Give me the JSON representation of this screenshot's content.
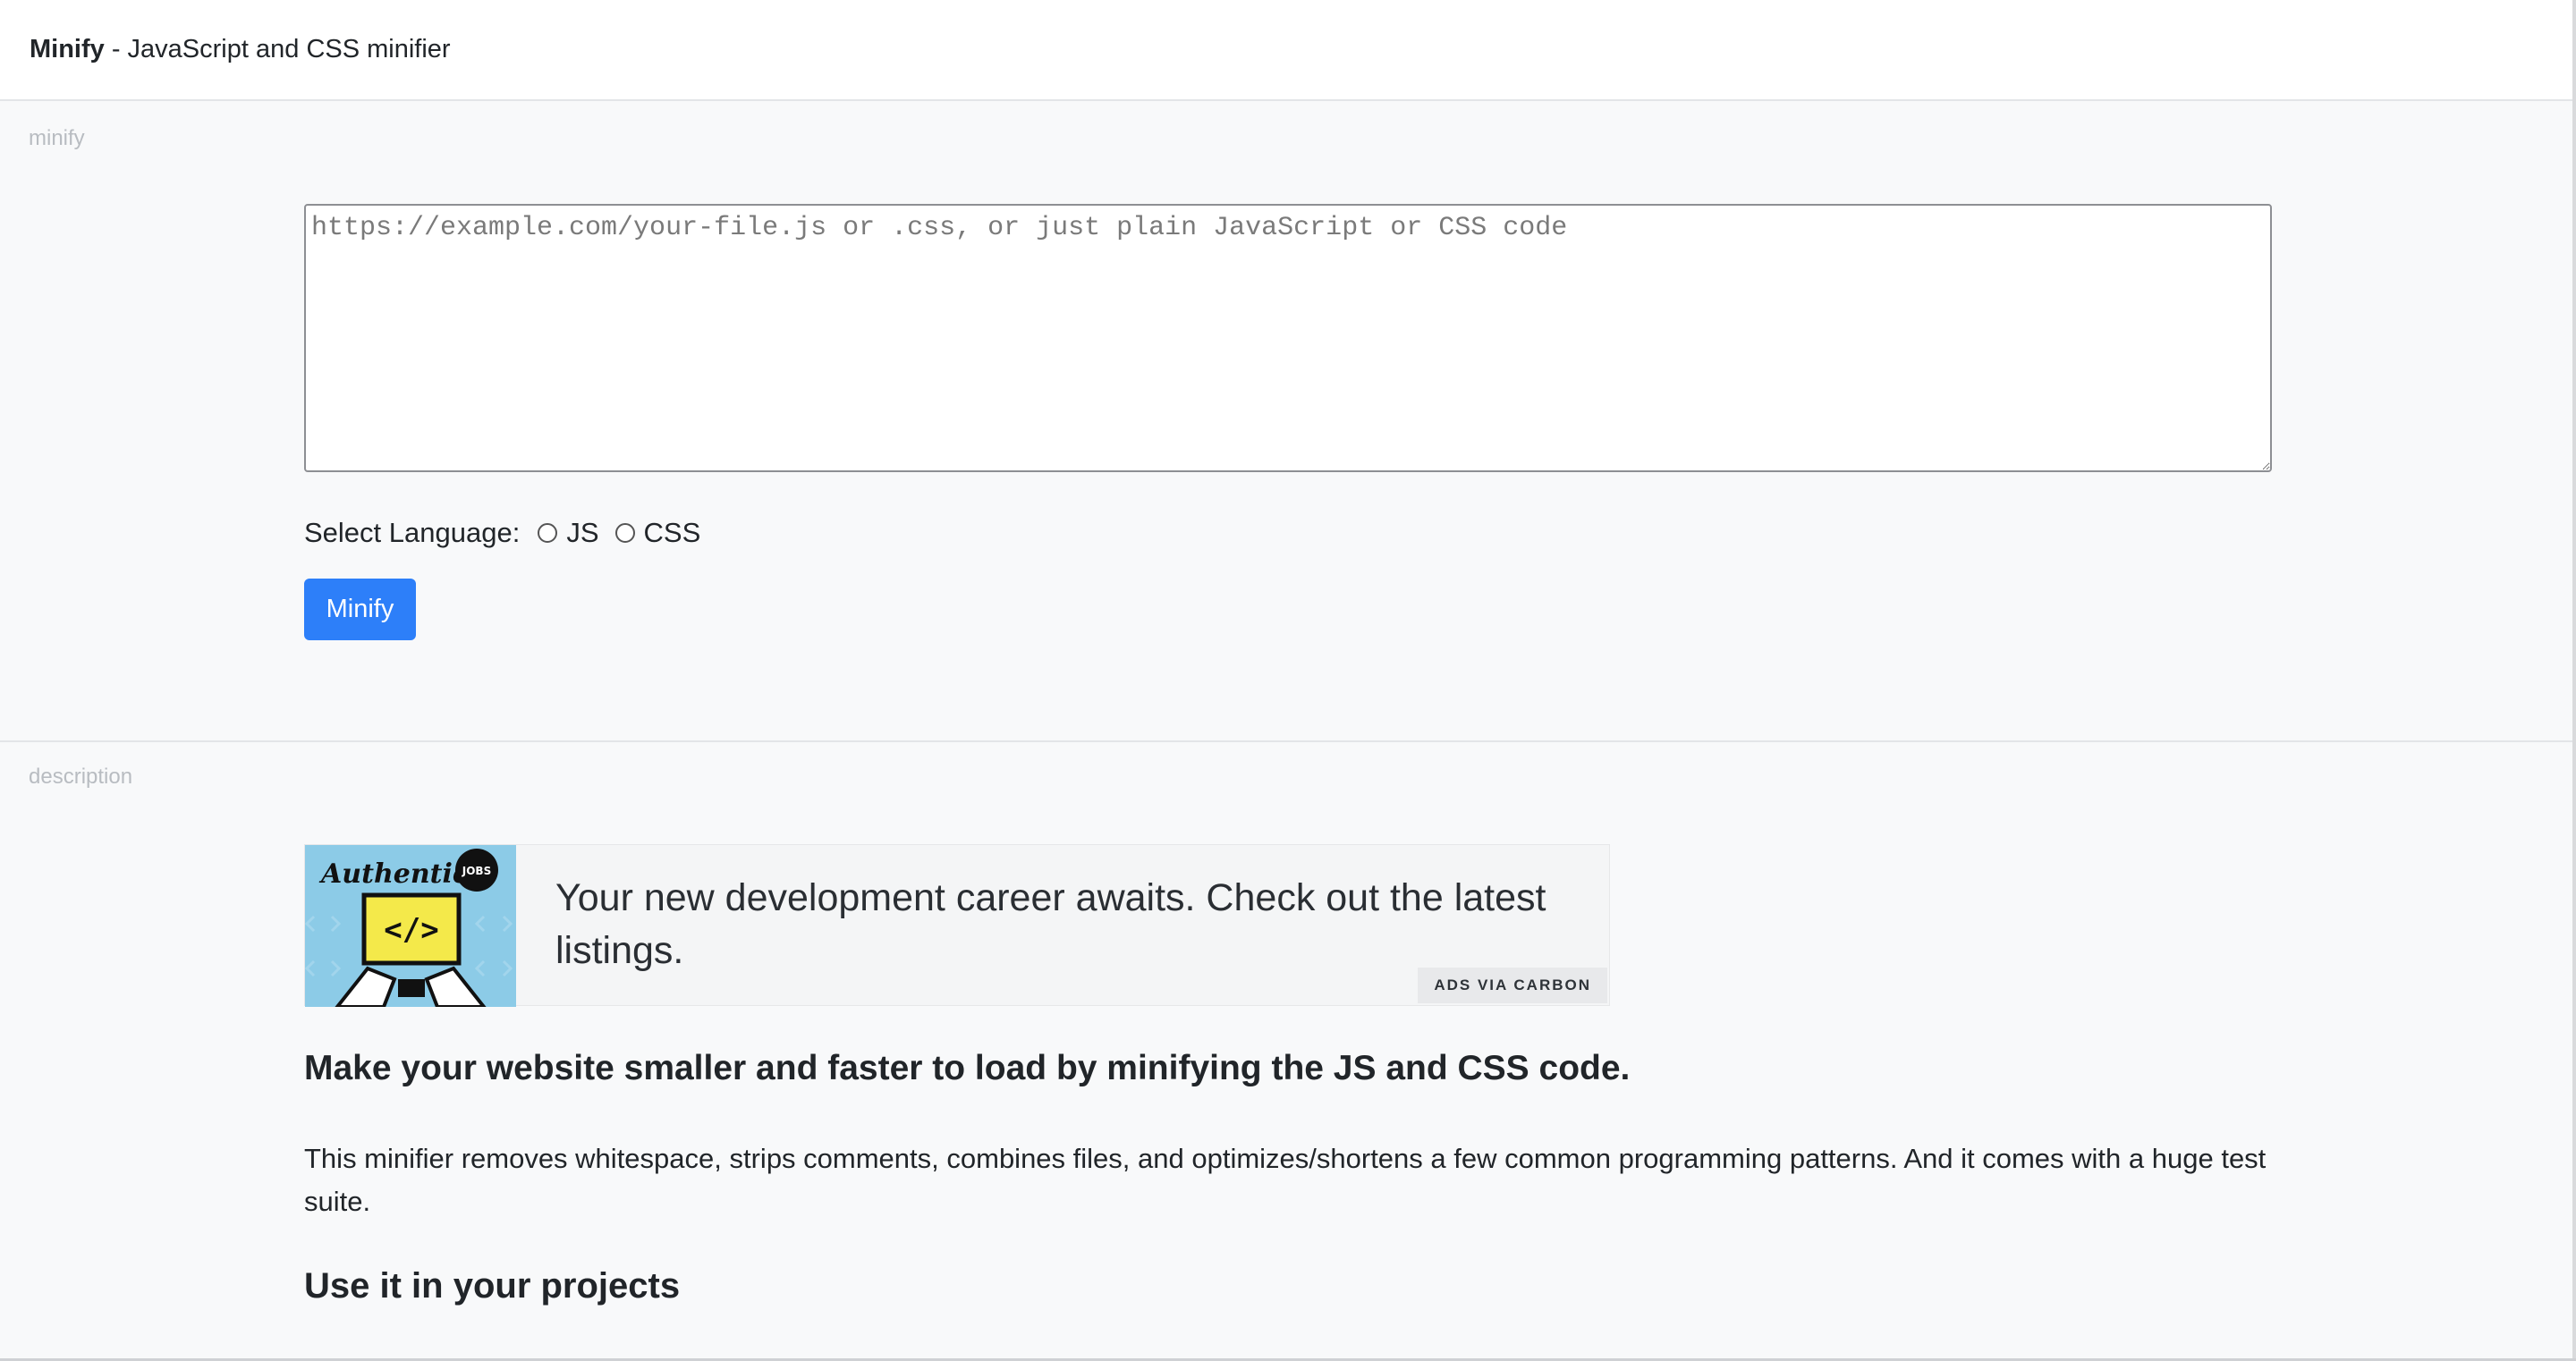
{
  "header": {
    "app_name": "Minify",
    "tagline": " - JavaScript and CSS minifier"
  },
  "minify_section": {
    "label": "minify",
    "input_placeholder": "https://example.com/your-file.js or .css, or just plain JavaScript or CSS code",
    "input_value": "",
    "language_label": "Select Language:",
    "language_options": [
      "JS",
      "CSS"
    ],
    "selected_language": null,
    "button_label": "Minify"
  },
  "description_section": {
    "label": "description",
    "ad": {
      "image_text": "Authentic",
      "badge": "JOBS",
      "code_symbol": "</>",
      "text": "Your new development career awaits. Check out the latest listings.",
      "via": "ADS VIA CARBON"
    },
    "headline": "Make your website smaller and faster to load by minifying the JS and CSS code.",
    "paragraph": "This minifier removes whitespace, strips comments, combines files, and optimizes/shortens a few common programming patterns. And it comes with a huge test suite.",
    "subheading": "Use it in your projects"
  },
  "colors": {
    "accent": "#2d7ff9",
    "page_bg": "#f8f9fa",
    "ad_image_bg": "#8ccbe7",
    "ad_screen": "#f4e94a"
  }
}
